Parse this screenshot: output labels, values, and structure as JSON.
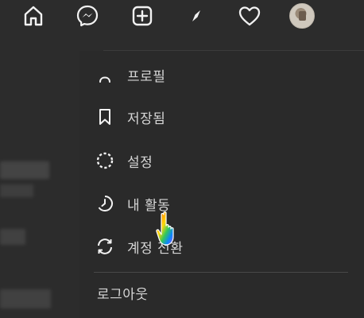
{
  "nav": {
    "icons": [
      {
        "name": "home-icon"
      },
      {
        "name": "messenger-icon"
      },
      {
        "name": "new-post-icon"
      },
      {
        "name": "explore-compass-icon"
      },
      {
        "name": "activity-heart-icon"
      },
      {
        "name": "profile-avatar"
      }
    ]
  },
  "menu": {
    "items": [
      {
        "label": "프로필",
        "icon": "profile-icon"
      },
      {
        "label": "저장됨",
        "icon": "bookmark-icon"
      },
      {
        "label": "설정",
        "icon": "settings-icon"
      },
      {
        "label": "내 활동",
        "icon": "activity-icon"
      },
      {
        "label": "계정 전환",
        "icon": "switch-account-icon"
      }
    ],
    "logout_label": "로그아웃"
  },
  "colors": {
    "background": "#2c2c2c",
    "menu_background": "#2a2a2a",
    "text": "#d6d6d6",
    "divider": "#484848",
    "icon": "#f2f2f2"
  }
}
